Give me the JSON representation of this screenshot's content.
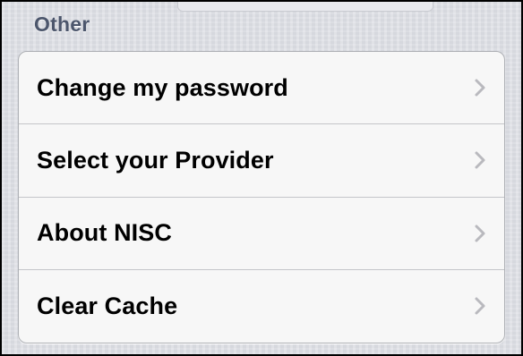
{
  "section": {
    "header": "Other"
  },
  "rows": [
    {
      "label": "Change my password",
      "icon": "chevron-right-icon"
    },
    {
      "label": "Select your Provider",
      "icon": "chevron-right-icon"
    },
    {
      "label": "About NISC",
      "icon": "chevron-right-icon"
    },
    {
      "label": "Clear Cache",
      "icon": "chevron-right-icon"
    }
  ],
  "colors": {
    "background": "#dcdee4",
    "section_header": "#4c566c",
    "cell_background": "#f7f7f7",
    "separator": "#c4c5c9",
    "chevron": "#b9b9be"
  }
}
